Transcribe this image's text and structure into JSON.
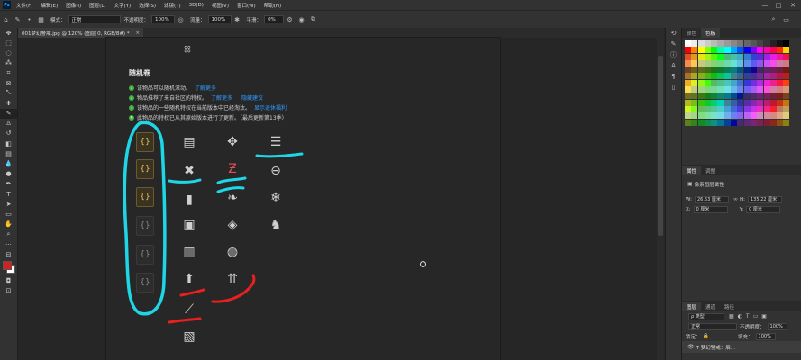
{
  "menubar": {
    "logo": "Ps",
    "items": [
      "文件(F)",
      "编辑(E)",
      "图像(I)",
      "图层(L)",
      "文字(Y)",
      "选择(S)",
      "滤镜(T)",
      "3D(D)",
      "视图(V)",
      "窗口(W)",
      "帮助(H)"
    ],
    "minimize": "—",
    "maximize": "□",
    "close": "✕"
  },
  "options": {
    "mode_label": "模式：",
    "mode_value": "正常",
    "opacity_label": "不透明度：",
    "opacity_value": "100%",
    "flow_label": "流量：",
    "flow_value": "100%",
    "smooth_label": "平滑：",
    "smooth_value": "0%"
  },
  "document": {
    "tab_title": "001梦幻警戒.jpg @ 120% (图层 0, RGB/8#) *",
    "tab_close": "×",
    "heading": "随机卷",
    "notes": [
      {
        "text": "该物品可以随机滚动。",
        "link": "了解更多"
      },
      {
        "text": "物品推荐了来自社区的特权。",
        "link": "了解更多",
        "link2": "隐藏建议"
      },
      {
        "text": "该物品的一些随机特权在当前版本中已经淘汰。",
        "link": "显示退休福利"
      },
      {
        "text": "此物品的特权已从其原始版本进行了更新。（最后更新第13季）",
        "link": ""
      }
    ]
  },
  "panels": {
    "swatches_tabs": [
      "颜色",
      "色板"
    ],
    "properties_tabs": [
      "属性",
      "调整"
    ],
    "properties_subtitle": "像素图层属性",
    "w_label": "W:",
    "w_value": "26.63 厘米",
    "h_label": "H:",
    "h_value": "135.22 厘米",
    "x_label": "X:",
    "x_value": "0 厘米",
    "y_label": "Y:",
    "y_value": "0 厘米",
    "layers_tabs": [
      "图层",
      "通道",
      "路径"
    ],
    "layers_kind": "ρ 类型",
    "blend_mode": "正常",
    "opacity_label": "不透明度：",
    "opacity_value": "100%",
    "lock_label": "锁定：",
    "fill_label": "填充：",
    "fill_value": "100%",
    "layer_name": "T 梦幻警戒：后..."
  },
  "colors": {
    "foreground": "#d42020",
    "background": "#ffffff",
    "cyan_annotation": "#1ed6e6",
    "red_annotation": "#e82020"
  }
}
